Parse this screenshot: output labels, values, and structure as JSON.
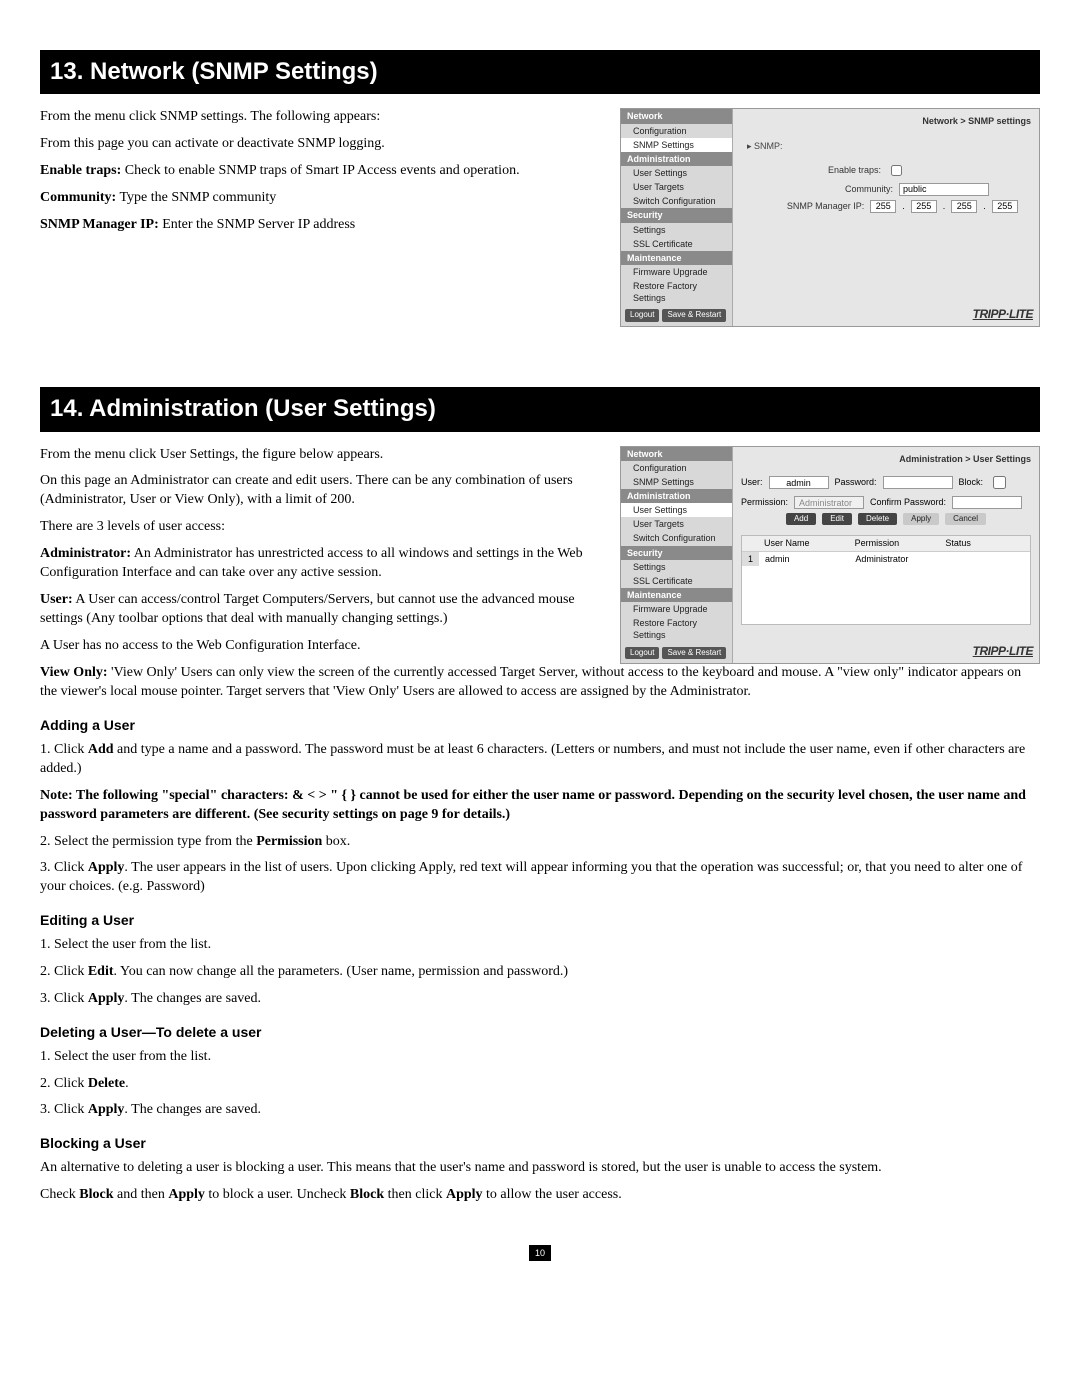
{
  "section13": {
    "heading": "13. Network (SNMP Settings)",
    "p1": "From the menu click SNMP settings. The following appears:",
    "p2": "From this page you can activate or deactivate SNMP logging.",
    "enable_label": "Enable traps:",
    "enable_rest": " Check to enable SNMP traps of Smart IP Access events and operation.",
    "community_label": "Community:",
    "community_rest": " Type the SNMP community",
    "mgrip_label": "SNMP Manager IP:",
    "mgrip_rest": " Enter the SNMP Server IP address"
  },
  "shot1": {
    "crumb": "Network > SNMP settings",
    "side": {
      "cat_network": "Network",
      "item_config": "Configuration",
      "item_snmp": "SNMP Settings",
      "cat_admin": "Administration",
      "item_user": "User Settings",
      "item_targets": "User Targets",
      "item_switch": "Switch Configuration",
      "cat_sec": "Security",
      "item_sec_settings": "Settings",
      "item_ssl": "SSL Certificate",
      "cat_maint": "Maintenance",
      "item_fw": "Firmware Upgrade",
      "item_restore": "Restore Factory Settings",
      "btn_logout": "Logout",
      "btn_save": "Save & Restart"
    },
    "panel": {
      "snmp_label": "SNMP:",
      "enable_traps": "Enable traps:",
      "community": "Community:",
      "community_value": "public",
      "mgr_ip": "SNMP Manager IP:",
      "ip_a": "255",
      "ip_b": "255",
      "ip_c": "255",
      "ip_d": "255"
    },
    "brand": "TRIPP·LITE"
  },
  "section14": {
    "heading": "14. Administration (User Settings)",
    "p1": "From the menu click User Settings, the figure below appears.",
    "p2": "On this page an Administrator can create and edit users. There can be any combination of users (Administrator, User or View Only), with a limit of 200.",
    "p3": "There are 3 levels of user access:",
    "admin_label": "Administrator:",
    "admin_rest": " An Administrator has unrestricted access to all windows and settings in the Web Configuration Interface and can take over any active session.",
    "user_label": "User:",
    "user_rest": " A User can access/control Target Computers/Servers, but cannot use the advanced mouse settings (Any toolbar options that deal with manually changing settings.)",
    "p_user_noaccess": "A User has no access to the Web Configuration Interface.",
    "view_label": "View Only:",
    "view_rest": " 'View Only' Users can only view the screen of the currently accessed Target Server, without access to the keyboard and mouse. A \"view only\" indicator appears on the viewer's local mouse pointer. Target servers that 'View Only' Users are allowed to access are assigned by the Administrator."
  },
  "shot2": {
    "crumb": "Administration > User Settings",
    "form": {
      "user_lbl": "User:",
      "user_val": "admin",
      "pass_lbl": "Password:",
      "block_lbl": "Block:",
      "perm_lbl": "Permission:",
      "perm_val": "Administrator",
      "conf_lbl": "Confirm Password:",
      "btn_add": "Add",
      "btn_edit": "Edit",
      "btn_delete": "Delete",
      "btn_apply": "Apply",
      "btn_cancel": "Cancel"
    },
    "table": {
      "col_user": "User Name",
      "col_perm": "Permission",
      "col_status": "Status",
      "row1_num": "1",
      "row1_user": "admin",
      "row1_perm": "Administrator"
    }
  },
  "adding": {
    "heading": "Adding a User",
    "s1a": "1. Click ",
    "s1b": "Add",
    "s1c": " and type a name and a password. The password must be at least 6 characters. (Letters or numbers, and must not include the user name, even if other characters are added.)",
    "note": "Note: The following \"special\" characters: & < > \" { } cannot be used for either the user name or password.  Depending on the security level chosen, the user name and password parameters are different. (See security settings on page 9 for details.)",
    "s2a": "2. Select the permission type from the ",
    "s2b": "Permission",
    "s2c": " box.",
    "s3a": "3. Click ",
    "s3b": "Apply",
    "s3c": ". The user appears in the list of users. Upon clicking Apply, red text will appear informing you that the operation was successful; or, that you need to alter one of your choices. (e.g. Password)"
  },
  "editing": {
    "heading": "Editing a User",
    "s1": "1. Select the user from the list.",
    "s2a": "2. Click ",
    "s2b": "Edit",
    "s2c": ". You can now change all the parameters. (User name, permission and password.)",
    "s3a": "3. Click ",
    "s3b": "Apply",
    "s3c": ". The changes are saved."
  },
  "deleting": {
    "heading": "Deleting a User—To delete a user",
    "s1": "1. Select the user from the list.",
    "s2a": "2. Click ",
    "s2b": "Delete",
    "s2c": ".",
    "s3a": "3. Click ",
    "s3b": "Apply",
    "s3c": ". The changes are saved."
  },
  "blocking": {
    "heading": "Blocking a User",
    "p1": "An alternative to deleting a user is blocking a user. This means that the user's name and password is stored, but the user is unable to access the system.",
    "p2a": "Check ",
    "p2b": "Block",
    "p2c": " and then ",
    "p2d": "Apply",
    "p2e": " to block a user. Uncheck ",
    "p2f": "Block",
    "p2g": " then click ",
    "p2h": "Apply",
    "p2i": " to allow the user access."
  },
  "page_number": "10"
}
